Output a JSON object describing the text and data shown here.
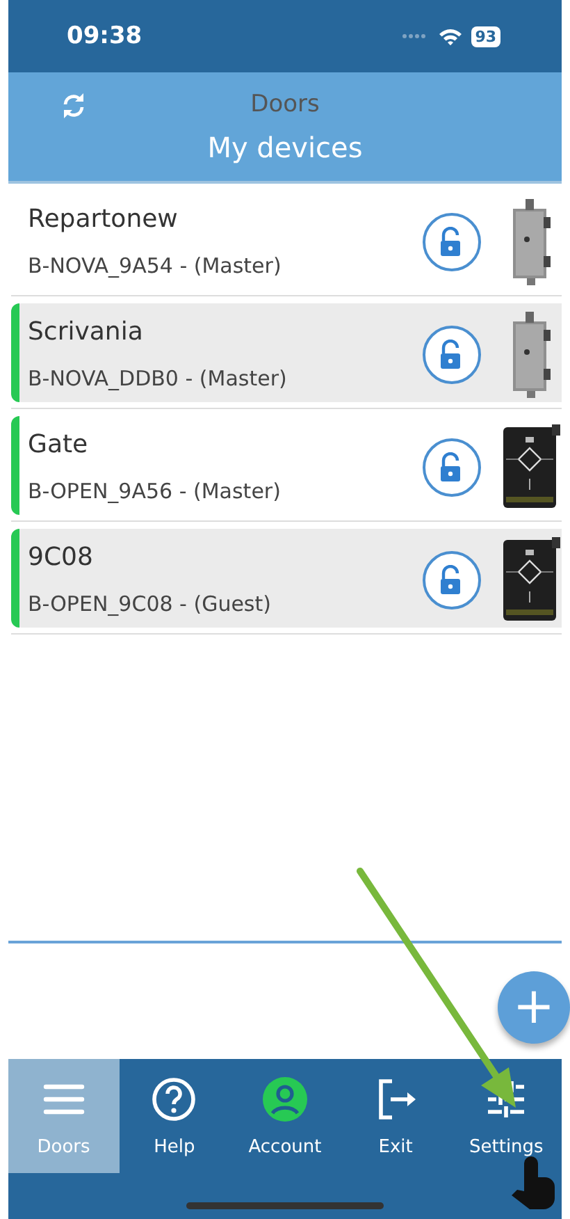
{
  "status_bar": {
    "time": "09:38",
    "battery": "93"
  },
  "header": {
    "title": "Doors",
    "subtitle": "My devices"
  },
  "devices": [
    {
      "name": "Repartonew",
      "subtitle": "B-NOVA_9A54 - (Master)",
      "online": false,
      "kind": "lock"
    },
    {
      "name": "Scrivania",
      "subtitle": "B-NOVA_DDB0 - (Master)",
      "online": true,
      "kind": "lock"
    },
    {
      "name": "Gate",
      "subtitle": "B-OPEN_9A56 - (Master)",
      "online": true,
      "kind": "controller"
    },
    {
      "name": "9C08",
      "subtitle": "B-OPEN_9C08 - (Guest)",
      "online": true,
      "kind": "controller"
    }
  ],
  "add_button": {
    "label": "+"
  },
  "nav": [
    {
      "label": "Doors",
      "kind": "menu",
      "selected": true
    },
    {
      "label": "Help",
      "kind": "help",
      "selected": false
    },
    {
      "label": "Account",
      "kind": "account",
      "selected": false
    },
    {
      "label": "Exit",
      "kind": "exit",
      "selected": false
    },
    {
      "label": "Settings",
      "kind": "settings",
      "selected": false
    }
  ]
}
